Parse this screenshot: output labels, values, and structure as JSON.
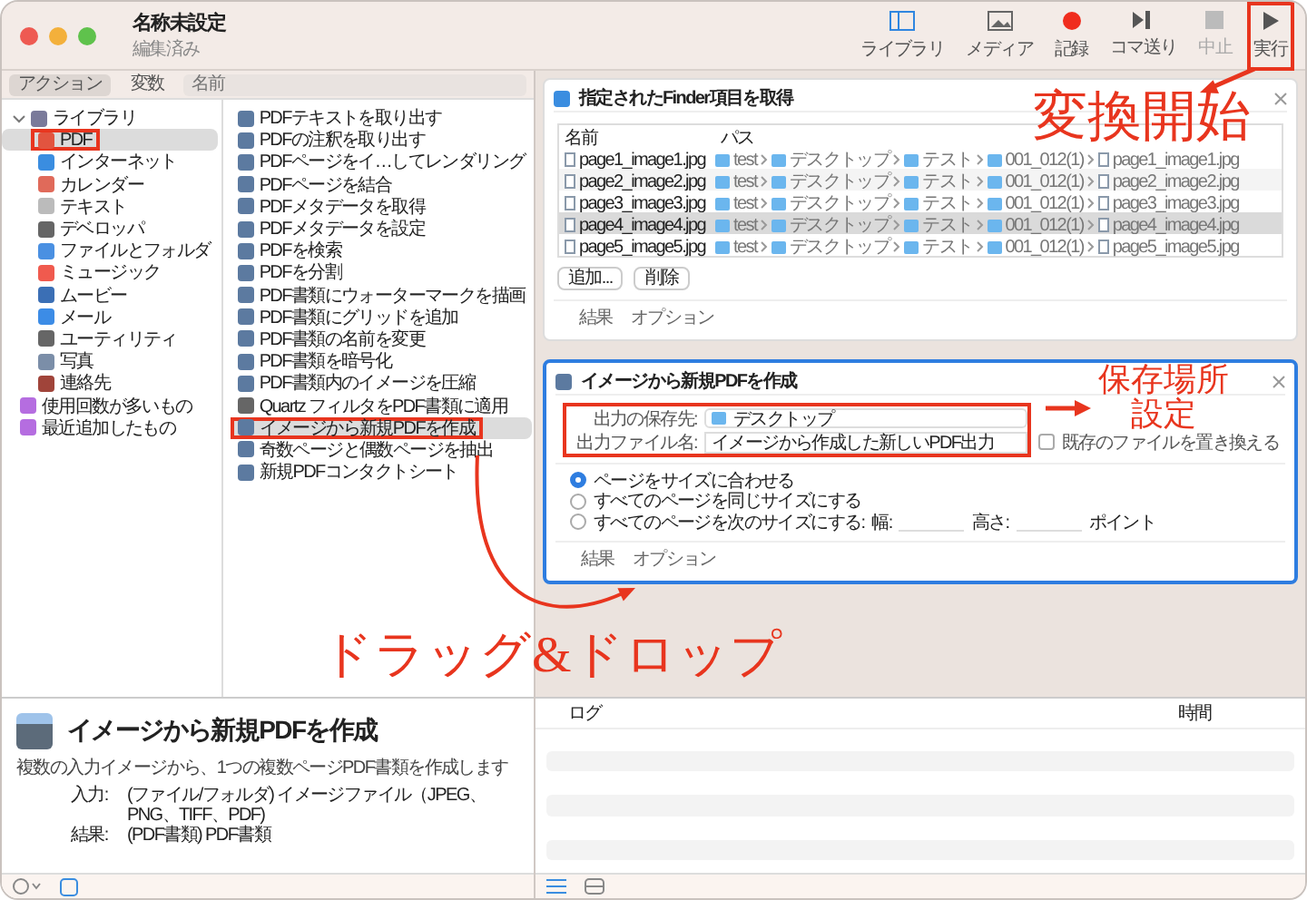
{
  "window": {
    "title": "名称未設定",
    "subtitle": "編集済み"
  },
  "toolbar": [
    {
      "label": "ライブラリ",
      "kind": "library",
      "disabled": false,
      "highlighted": false
    },
    {
      "label": "メディア",
      "kind": "media",
      "disabled": false,
      "highlighted": false
    },
    {
      "label": "記録",
      "kind": "record",
      "disabled": false,
      "highlighted": false
    },
    {
      "label": "コマ送り",
      "kind": "step",
      "disabled": false,
      "highlighted": false
    },
    {
      "label": "中止",
      "kind": "stop",
      "disabled": true,
      "highlighted": false
    },
    {
      "label": "実行",
      "kind": "run",
      "disabled": false,
      "highlighted": true
    }
  ],
  "sidebar_tabs": [
    {
      "label": "アクション",
      "selected": true
    },
    {
      "label": "変数",
      "selected": false
    }
  ],
  "search": {
    "placeholder": "名前"
  },
  "library": {
    "label": "ライブラリ",
    "expanded": true,
    "children": [
      {
        "label": "PDF",
        "kind": "pdf",
        "selected": true,
        "highlighted": true
      },
      {
        "label": "インターネット",
        "kind": "internet",
        "selected": false,
        "highlighted": false
      },
      {
        "label": "カレンダー",
        "kind": "calendar",
        "selected": false,
        "highlighted": false
      },
      {
        "label": "テキスト",
        "kind": "text",
        "selected": false,
        "highlighted": false
      },
      {
        "label": "デベロッパ",
        "kind": "tools",
        "selected": false,
        "highlighted": false
      },
      {
        "label": "ファイルとフォルダ",
        "kind": "files",
        "selected": false,
        "highlighted": false
      },
      {
        "label": "ミュージック",
        "kind": "music",
        "selected": false,
        "highlighted": false
      },
      {
        "label": "ムービー",
        "kind": "movie",
        "selected": false,
        "highlighted": false
      },
      {
        "label": "メール",
        "kind": "mail",
        "selected": false,
        "highlighted": false
      },
      {
        "label": "ユーティリティ",
        "kind": "tools",
        "selected": false,
        "highlighted": false
      },
      {
        "label": "写真",
        "kind": "photo",
        "selected": false,
        "highlighted": false
      },
      {
        "label": "連絡先",
        "kind": "contacts",
        "selected": false,
        "highlighted": false
      }
    ]
  },
  "smart_groups": [
    {
      "label": "使用回数が多いもの"
    },
    {
      "label": "最近追加したもの"
    }
  ],
  "actions": [
    {
      "label": "PDFテキストを取り出す",
      "kind": "document",
      "selected": false,
      "highlighted": false
    },
    {
      "label": "PDFの注釈を取り出す",
      "kind": "document",
      "selected": false,
      "highlighted": false
    },
    {
      "label": "PDFページをイ…してレンダリング",
      "kind": "document",
      "selected": false,
      "highlighted": false
    },
    {
      "label": "PDFページを結合",
      "kind": "document",
      "selected": false,
      "highlighted": false
    },
    {
      "label": "PDFメタデータを取得",
      "kind": "document",
      "selected": false,
      "highlighted": false
    },
    {
      "label": "PDFメタデータを設定",
      "kind": "document",
      "selected": false,
      "highlighted": false
    },
    {
      "label": "PDFを検索",
      "kind": "document",
      "selected": false,
      "highlighted": false
    },
    {
      "label": "PDFを分割",
      "kind": "document",
      "selected": false,
      "highlighted": false
    },
    {
      "label": "PDF書類にウォーターマークを描画",
      "kind": "document",
      "selected": false,
      "highlighted": false
    },
    {
      "label": "PDF書類にグリッドを追加",
      "kind": "document",
      "selected": false,
      "highlighted": false
    },
    {
      "label": "PDF書類の名前を変更",
      "kind": "document",
      "selected": false,
      "highlighted": false
    },
    {
      "label": "PDF書類を暗号化",
      "kind": "document",
      "selected": false,
      "highlighted": false
    },
    {
      "label": "PDF書類内のイメージを圧縮",
      "kind": "document",
      "selected": false,
      "highlighted": false
    },
    {
      "label": "Quartz フィルタをPDF書類に適用",
      "kind": "tools",
      "selected": false,
      "highlighted": false
    },
    {
      "label": "イメージから新規PDFを作成",
      "kind": "document",
      "selected": true,
      "highlighted": true
    },
    {
      "label": "奇数ページと偶数ページを抽出",
      "kind": "document",
      "selected": false,
      "highlighted": false
    },
    {
      "label": "新規PDFコンタクトシート",
      "kind": "document",
      "selected": false,
      "highlighted": false
    }
  ],
  "description": {
    "title": "イメージから新規PDFを作成",
    "text": "複数の入力イメージから、1つの複数ページPDF書類を作成します",
    "input_label": "入力:",
    "input": "(ファイル/フォルダ) イメージファイル（JPEG、PNG、TIFF、PDF)",
    "result_label": "結果:",
    "result": "(PDF書類) PDF書類"
  },
  "finder_action": {
    "title": "指定されたFinder項目を取得",
    "columns": [
      "名前",
      "パス"
    ],
    "rows": [
      {
        "name": "page1_image1.jpg",
        "path": [
          "test",
          "デスクトップ",
          "テスト",
          "001_012(1)",
          "page1_image1.jpg"
        ],
        "selected": false
      },
      {
        "name": "page2_image2.jpg",
        "path": [
          "test",
          "デスクトップ",
          "テスト",
          "001_012(1)",
          "page2_image2.jpg"
        ],
        "selected": false
      },
      {
        "name": "page3_image3.jpg",
        "path": [
          "test",
          "デスクトップ",
          "テスト",
          "001_012(1)",
          "page3_image3.jpg"
        ],
        "selected": false
      },
      {
        "name": "page4_image4.jpg",
        "path": [
          "test",
          "デスクトップ",
          "テスト",
          "001_012(1)",
          "page4_image4.jpg"
        ],
        "selected": true
      },
      {
        "name": "page5_image5.jpg",
        "path": [
          "test",
          "デスクトップ",
          "テスト",
          "001_012(1)",
          "page5_image5.jpg"
        ],
        "selected": false
      }
    ],
    "buttons": [
      "追加...",
      "削除"
    ],
    "footer": [
      "結果",
      "オプション"
    ]
  },
  "pdf_action": {
    "title": "イメージから新規PDFを作成",
    "selected": true,
    "save_label": "出力の保存先:",
    "save_value": "デスクトップ",
    "file_label": "出力ファイル名:",
    "file_value": "イメージから作成した新しいPDF出力",
    "replace": {
      "label": "既存のファイルを置き換える",
      "checked": false
    },
    "options": [
      {
        "label": "ページをサイズに合わせる",
        "selected": true,
        "kind": "plain"
      },
      {
        "label": "すべてのページを同じサイズにする",
        "selected": false,
        "kind": "plain"
      },
      {
        "label": "すべてのページを次のサイズにする:",
        "selected": false,
        "kind": "size",
        "width_label": "幅:",
        "height_label": "高さ:",
        "unit": "ポイント"
      }
    ],
    "footer": [
      "結果",
      "オプション"
    ]
  },
  "log": {
    "columns": [
      "ログ",
      "時間"
    ]
  },
  "annotations": [
    {
      "kind": "run",
      "lines": [
        "変換開始"
      ]
    },
    {
      "kind": "save",
      "lines": [
        "保存場所",
        "設定"
      ]
    },
    {
      "kind": "drag",
      "lines": [
        "ドラッグ&ドロップ"
      ]
    }
  ]
}
